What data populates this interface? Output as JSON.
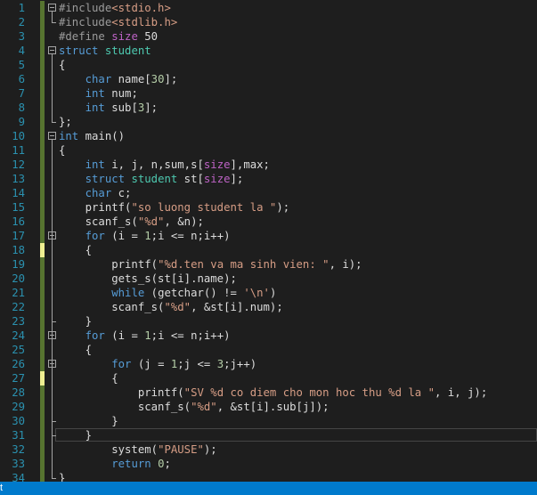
{
  "editor": {
    "colors": {
      "background": "#1e1e1e",
      "line_number": "#2b91af",
      "keyword": "#569cd6",
      "type": "#4ec9b0",
      "string": "#d69d85",
      "number": "#b5cea8",
      "macro": "#bd63c5",
      "preprocessor": "#9b9b9b",
      "text": "#dcdcdc",
      "saved_change_bar": "#577430",
      "unsaved_change_bar": "#efef91"
    },
    "lines": [
      {
        "n": "1",
        "bar": "saved",
        "fold": true,
        "tokens": [
          [
            "pp",
            "#include"
          ],
          [
            "str",
            "<stdio.h>"
          ]
        ]
      },
      {
        "n": "2",
        "bar": "saved",
        "fold": false,
        "tokens": [
          [
            "pp",
            "#include"
          ],
          [
            "str",
            "<stdlib.h>"
          ]
        ]
      },
      {
        "n": "3",
        "bar": "saved",
        "fold": false,
        "tokens": [
          [
            "pp",
            "#define "
          ],
          [
            "mac",
            "size"
          ],
          [
            "def",
            " 50"
          ]
        ]
      },
      {
        "n": "4",
        "bar": "saved",
        "fold": true,
        "tokens": [
          [
            "kw",
            "struct"
          ],
          [
            "def",
            " "
          ],
          [
            "ty",
            "student"
          ]
        ]
      },
      {
        "n": "5",
        "bar": "saved",
        "fold": false,
        "tokens": [
          [
            "def",
            "{"
          ]
        ]
      },
      {
        "n": "6",
        "bar": "saved",
        "fold": false,
        "tokens": [
          [
            "def",
            "    "
          ],
          [
            "kw",
            "char"
          ],
          [
            "def",
            " name["
          ],
          [
            "num",
            "30"
          ],
          [
            "def",
            "];"
          ]
        ]
      },
      {
        "n": "7",
        "bar": "saved",
        "fold": false,
        "tokens": [
          [
            "def",
            "    "
          ],
          [
            "kw",
            "int"
          ],
          [
            "def",
            " num;"
          ]
        ]
      },
      {
        "n": "8",
        "bar": "saved",
        "fold": false,
        "tokens": [
          [
            "def",
            "    "
          ],
          [
            "kw",
            "int"
          ],
          [
            "def",
            " sub["
          ],
          [
            "num",
            "3"
          ],
          [
            "def",
            "];"
          ]
        ]
      },
      {
        "n": "9",
        "bar": "saved",
        "fold": false,
        "tokens": [
          [
            "def",
            "};"
          ]
        ]
      },
      {
        "n": "10",
        "bar": "saved",
        "fold": true,
        "tokens": [
          [
            "kw",
            "int"
          ],
          [
            "def",
            " main()"
          ]
        ]
      },
      {
        "n": "11",
        "bar": "saved",
        "fold": false,
        "tokens": [
          [
            "def",
            "{"
          ]
        ]
      },
      {
        "n": "12",
        "bar": "saved",
        "fold": false,
        "tokens": [
          [
            "def",
            "    "
          ],
          [
            "kw",
            "int"
          ],
          [
            "def",
            " i, j, n,sum,s["
          ],
          [
            "mac",
            "size"
          ],
          [
            "def",
            "],max;"
          ]
        ]
      },
      {
        "n": "13",
        "bar": "saved",
        "fold": false,
        "tokens": [
          [
            "def",
            "    "
          ],
          [
            "kw",
            "struct"
          ],
          [
            "def",
            " "
          ],
          [
            "ty",
            "student"
          ],
          [
            "def",
            " st["
          ],
          [
            "mac",
            "size"
          ],
          [
            "def",
            "];"
          ]
        ]
      },
      {
        "n": "14",
        "bar": "saved",
        "fold": false,
        "tokens": [
          [
            "def",
            "    "
          ],
          [
            "kw",
            "char"
          ],
          [
            "def",
            " c;"
          ]
        ]
      },
      {
        "n": "15",
        "bar": "saved",
        "fold": false,
        "tokens": [
          [
            "def",
            "    printf("
          ],
          [
            "str",
            "\"so luong student la \""
          ],
          [
            "def",
            ");"
          ]
        ]
      },
      {
        "n": "16",
        "bar": "saved",
        "fold": false,
        "tokens": [
          [
            "def",
            "    scanf_s("
          ],
          [
            "str",
            "\"%d\""
          ],
          [
            "def",
            ", &n);"
          ]
        ]
      },
      {
        "n": "17",
        "bar": "saved",
        "fold": true,
        "tokens": [
          [
            "def",
            "    "
          ],
          [
            "kw",
            "for"
          ],
          [
            "def",
            " (i = "
          ],
          [
            "num",
            "1"
          ],
          [
            "def",
            ";i <= n;i++)"
          ]
        ]
      },
      {
        "n": "18",
        "bar": "changed",
        "fold": false,
        "tokens": [
          [
            "def",
            "    {"
          ]
        ]
      },
      {
        "n": "19",
        "bar": "saved",
        "fold": false,
        "tokens": [
          [
            "def",
            "        printf("
          ],
          [
            "str",
            "\"%d.ten va ma sinh vien: \""
          ],
          [
            "def",
            ", i);"
          ]
        ]
      },
      {
        "n": "20",
        "bar": "saved",
        "fold": false,
        "tokens": [
          [
            "def",
            "        gets_s(st[i].name);"
          ]
        ]
      },
      {
        "n": "21",
        "bar": "saved",
        "fold": false,
        "tokens": [
          [
            "def",
            "        "
          ],
          [
            "kw",
            "while"
          ],
          [
            "def",
            " (getchar() != "
          ],
          [
            "str",
            "'\\n'"
          ],
          [
            "def",
            ")"
          ]
        ]
      },
      {
        "n": "22",
        "bar": "saved",
        "fold": false,
        "tokens": [
          [
            "def",
            "        scanf_s("
          ],
          [
            "str",
            "\"%d\""
          ],
          [
            "def",
            ", &st[i].num);"
          ]
        ]
      },
      {
        "n": "23",
        "bar": "saved",
        "fold": false,
        "tokens": [
          [
            "def",
            "    }"
          ]
        ]
      },
      {
        "n": "24",
        "bar": "saved",
        "fold": true,
        "tokens": [
          [
            "def",
            "    "
          ],
          [
            "kw",
            "for"
          ],
          [
            "def",
            " (i = "
          ],
          [
            "num",
            "1"
          ],
          [
            "def",
            ";i <= n;i++)"
          ]
        ]
      },
      {
        "n": "25",
        "bar": "saved",
        "fold": false,
        "tokens": [
          [
            "def",
            "    {"
          ]
        ]
      },
      {
        "n": "26",
        "bar": "saved",
        "fold": true,
        "tokens": [
          [
            "def",
            "        "
          ],
          [
            "kw",
            "for"
          ],
          [
            "def",
            " (j = "
          ],
          [
            "num",
            "1"
          ],
          [
            "def",
            ";j <= "
          ],
          [
            "num",
            "3"
          ],
          [
            "def",
            ";j++)"
          ]
        ]
      },
      {
        "n": "27",
        "bar": "changed",
        "fold": false,
        "tokens": [
          [
            "def",
            "        {"
          ]
        ]
      },
      {
        "n": "28",
        "bar": "saved",
        "fold": false,
        "tokens": [
          [
            "def",
            "            printf("
          ],
          [
            "str",
            "\"SV %d co diem cho mon hoc thu %d la \""
          ],
          [
            "def",
            ", i, j);"
          ]
        ]
      },
      {
        "n": "29",
        "bar": "saved",
        "fold": false,
        "tokens": [
          [
            "def",
            "            scanf_s("
          ],
          [
            "str",
            "\"%d\""
          ],
          [
            "def",
            ", &st[i].sub[j]);"
          ]
        ]
      },
      {
        "n": "30",
        "bar": "saved",
        "fold": false,
        "tokens": [
          [
            "def",
            "        }"
          ]
        ]
      },
      {
        "n": "31",
        "bar": "saved",
        "fold": false,
        "current": true,
        "tokens": [
          [
            "def",
            "    }"
          ]
        ]
      },
      {
        "n": "32",
        "bar": "saved",
        "fold": false,
        "tokens": [
          [
            "def",
            "        system("
          ],
          [
            "str",
            "\"PAUSE\""
          ],
          [
            "def",
            ");"
          ]
        ]
      },
      {
        "n": "33",
        "bar": "saved",
        "fold": false,
        "tokens": [
          [
            "def",
            "        "
          ],
          [
            "kw",
            "return"
          ],
          [
            "def",
            " "
          ],
          [
            "num",
            "0"
          ],
          [
            "def",
            ";"
          ]
        ]
      },
      {
        "n": "34",
        "bar": "saved",
        "fold": false,
        "tokens": [
          [
            "def",
            "}"
          ]
        ]
      }
    ]
  },
  "statusbar": {
    "text": "t",
    "color": "#007acc"
  }
}
